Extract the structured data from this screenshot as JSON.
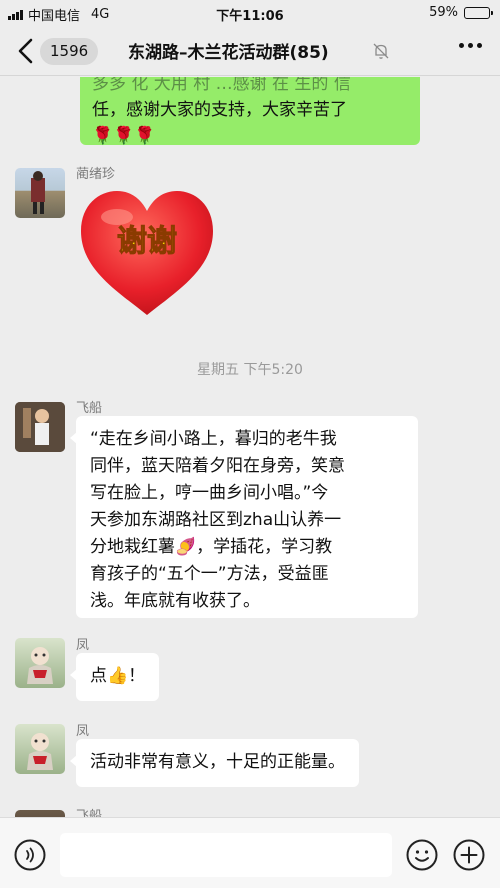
{
  "status_bar": {
    "carrier": "中国电信",
    "network": "4G",
    "time": "下午11:06",
    "battery": "59%",
    "battery_level": 0.59
  },
  "header": {
    "unread_count": "1596",
    "title": "东湖路–木兰花活动群(85)",
    "muted": true
  },
  "messages": [
    {
      "type": "outgoing_partial",
      "lines": [
        "多多 化 大用 村 …感谢 在 生的 信",
        "任，感谢大家的支持，大家辛苦了",
        "🌹🌹🌹"
      ]
    },
    {
      "type": "sticker",
      "sender": "蔺绪珍",
      "sticker_text": "谢谢"
    },
    {
      "type": "timestamp",
      "text": "星期五 下午5:20"
    },
    {
      "type": "text",
      "sender": "飞船",
      "lines": [
        "“走在乡间小路上，暮归的老牛我",
        "同伴，蓝天陪着夕阳在身旁，笑意",
        "写在脸上，哼一曲乡间小唱。”今",
        "天参加东湖路社区到zha山认养一",
        "分地栽红薯🍠，学插花，学习教",
        "育孩子的“五个一”方法，受益匪",
        "浅。年底就有收获了。"
      ]
    },
    {
      "type": "text",
      "sender": "凤",
      "text": "点👍！"
    },
    {
      "type": "text",
      "sender": "凤",
      "text": "活动非常有意义，十足的正能量。"
    },
    {
      "type": "partial",
      "sender": "飞船"
    }
  ],
  "colors": {
    "background": "#ededed",
    "outgoing_bubble": "#95ec69",
    "incoming_bubble": "#ffffff",
    "battery": "#f2b705",
    "heart": "#e8202a",
    "sticker_text": "#ffe100"
  },
  "input_bar": {
    "voice_icon": "voice-icon",
    "emoji_icon": "emoji-icon",
    "plus_icon": "plus-icon"
  }
}
